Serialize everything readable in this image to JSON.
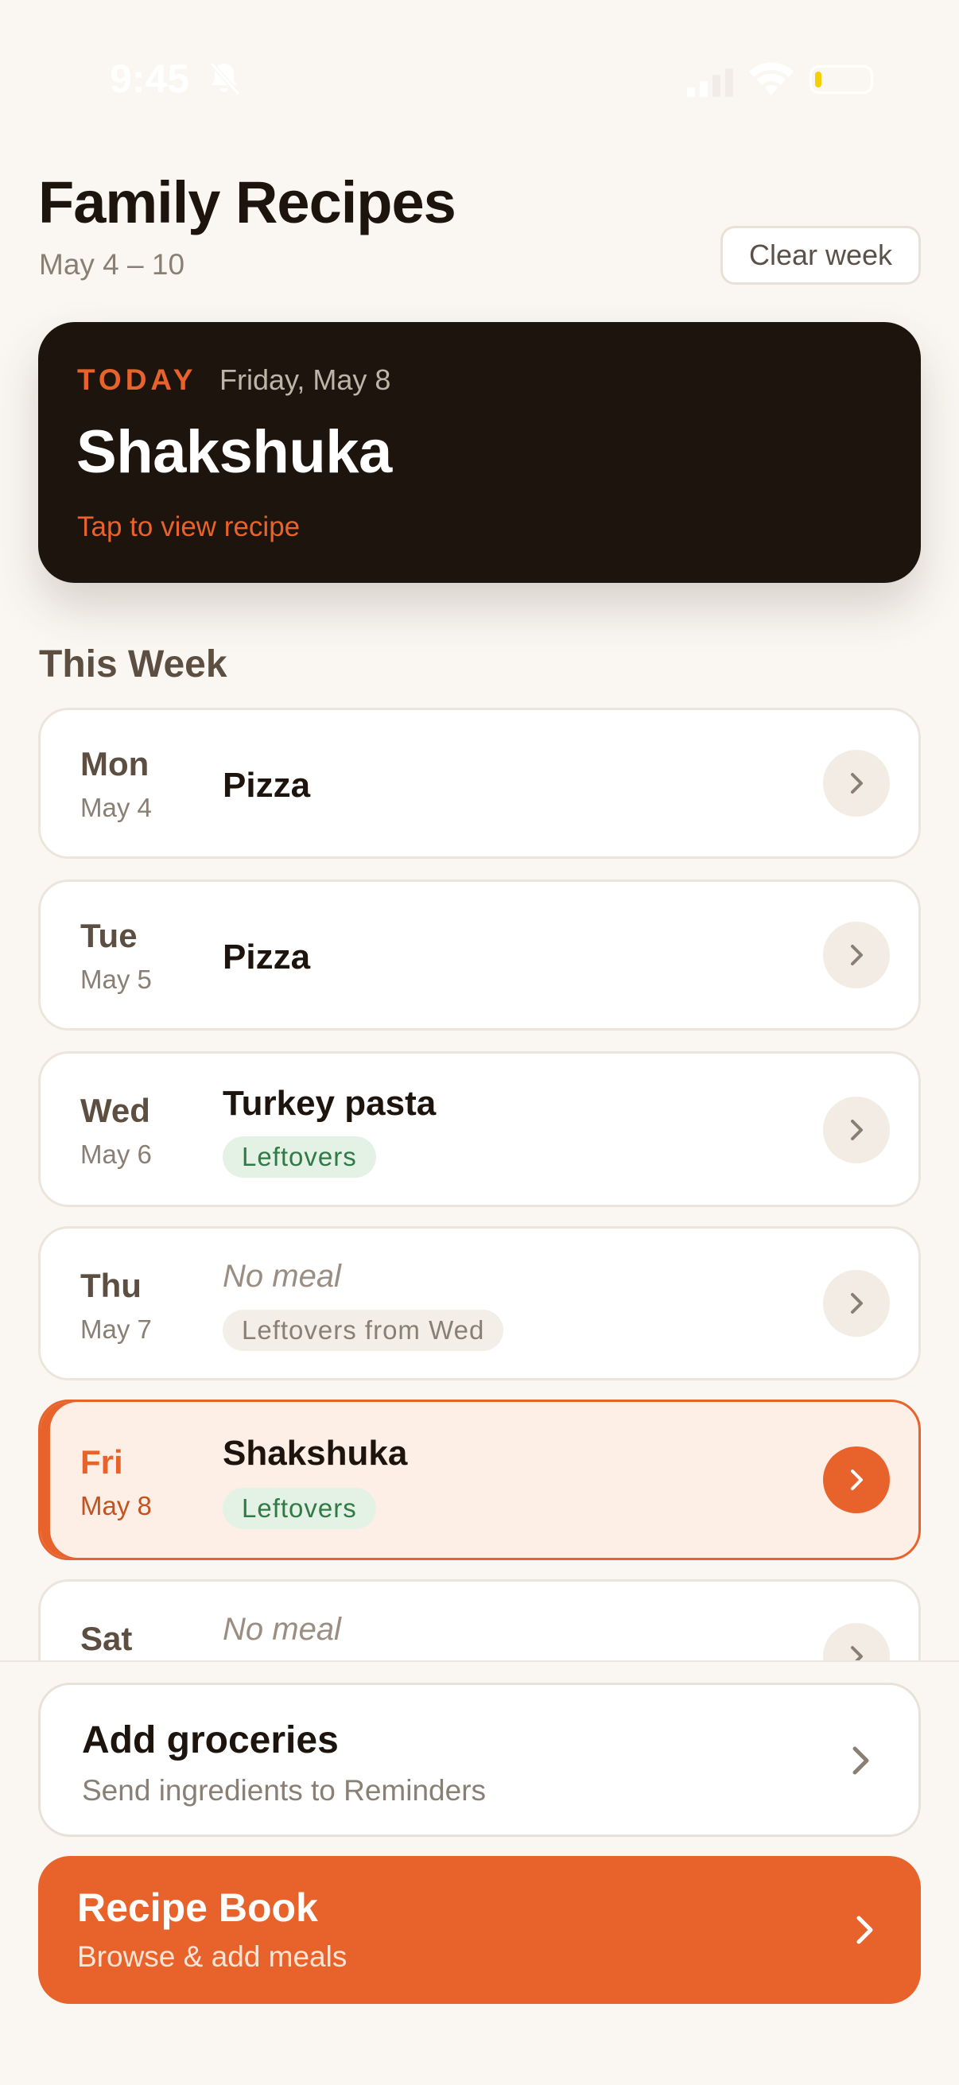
{
  "status_bar": {
    "time": "9:45",
    "icons": [
      "bell-off-icon",
      "signal-icon",
      "wifi-icon",
      "battery-icon"
    ],
    "battery_level": 0.12
  },
  "header": {
    "title": "Family Recipes",
    "week_range": "May 4 – 10",
    "clear_week_label": "Clear week"
  },
  "today": {
    "label": "TODAY",
    "date": "Friday, May 8",
    "meal": "Shakshuka",
    "cta": "Tap to view recipe"
  },
  "week": {
    "section_title": "This Week",
    "days": [
      {
        "day": "Mon",
        "date": "May 4",
        "meal": "Pizza",
        "tag": ""
      },
      {
        "day": "Tue",
        "date": "May 5",
        "meal": "Pizza",
        "tag": ""
      },
      {
        "day": "Wed",
        "date": "May 6",
        "meal": "Turkey pasta",
        "tag": "Leftovers"
      },
      {
        "day": "Thu",
        "date": "May 7",
        "meal": "No meal",
        "tag": "Leftovers from Wed"
      },
      {
        "day": "Fri",
        "date": "May 8",
        "meal": "Shakshuka",
        "tag": "Leftovers"
      },
      {
        "day": "Sat",
        "date": "",
        "meal": "No meal",
        "tag": ""
      }
    ]
  },
  "groceries": {
    "title": "Add groceries",
    "subtitle": "Send ingredients to Reminders"
  },
  "recipe_book": {
    "title": "Recipe Book",
    "subtitle": "Browse & add meals"
  },
  "colors": {
    "accent": "#E8632B",
    "background": "#FAF7F2",
    "dark_card": "#1D140D",
    "leftovers_tag": "#E4F2E6"
  }
}
